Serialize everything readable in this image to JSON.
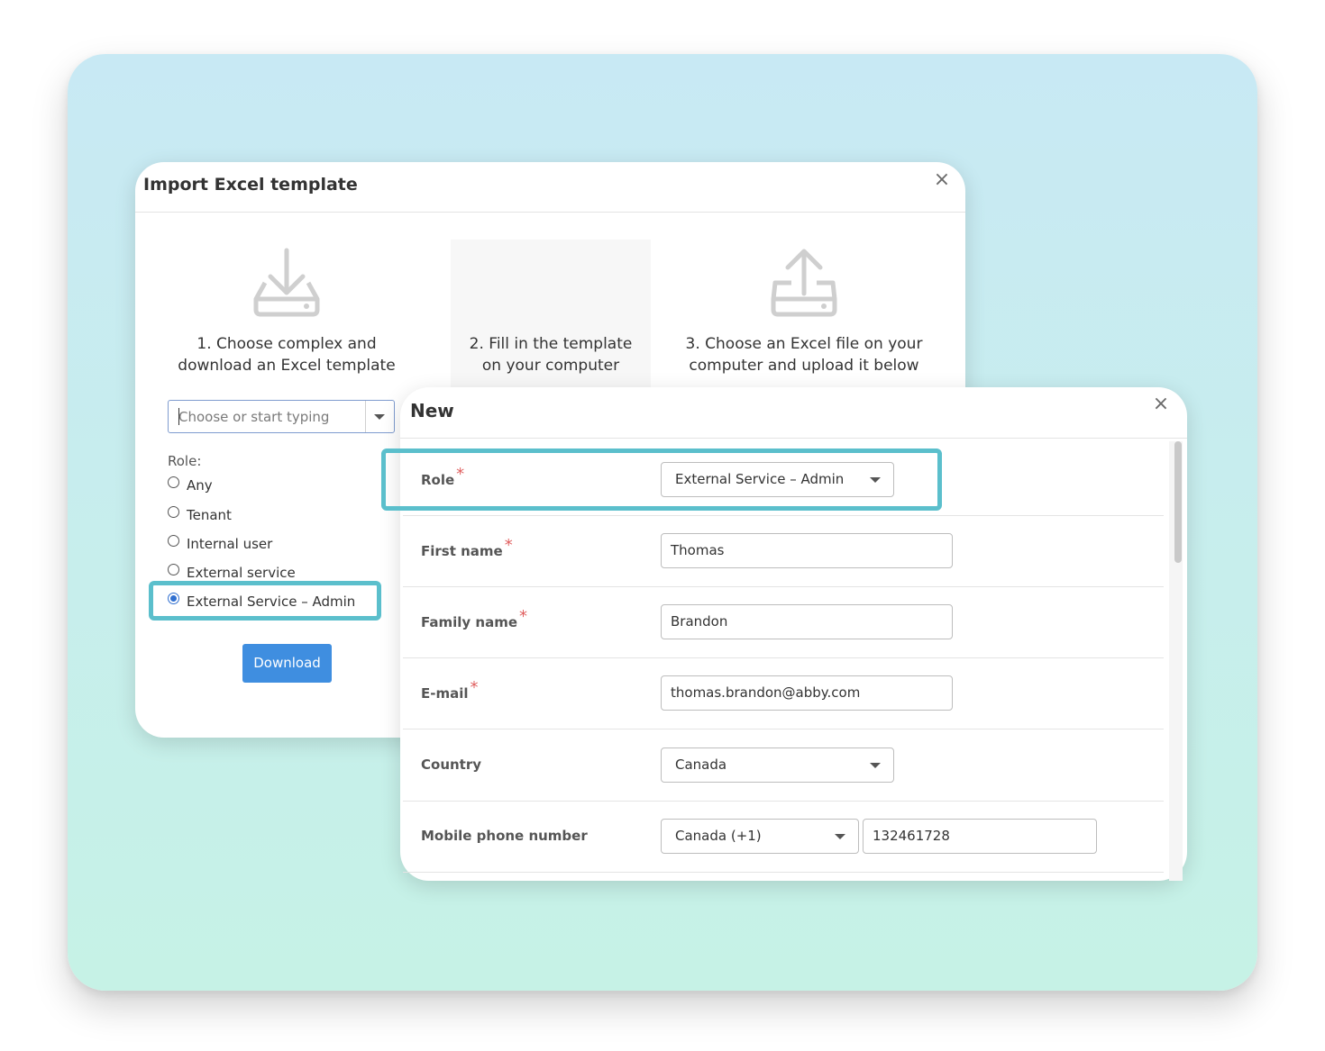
{
  "import_dialog": {
    "title": "Import Excel template",
    "close": "×",
    "steps": [
      {
        "icon": "download-tray-icon",
        "line1": "1. Choose complex and",
        "line2": "download an Excel template"
      },
      {
        "icon": "",
        "line1": "2. Fill in the template",
        "line2": "on your computer"
      },
      {
        "icon": "upload-tray-icon",
        "line1": "3. Choose an Excel file on your",
        "line2": "computer and upload it below"
      }
    ],
    "complex_select": {
      "placeholder": "Choose or start typing"
    },
    "role_label": "Role:",
    "roles": [
      "Any",
      "Tenant",
      "Internal user",
      "External service",
      "External Service – Admin"
    ],
    "selected_role": "External Service – Admin",
    "download_button": "Download"
  },
  "new_dialog": {
    "title": "New",
    "close": "×",
    "fields": {
      "role": {
        "label": "Role",
        "required": "*",
        "value": "External Service – Admin"
      },
      "first_name": {
        "label": "First name",
        "required": "*",
        "value": "Thomas"
      },
      "family_name": {
        "label": "Family name",
        "required": "*",
        "value": "Brandon"
      },
      "email": {
        "label": "E-mail",
        "required": "*",
        "value": "thomas.brandon@abby.com"
      },
      "country": {
        "label": "Country",
        "value": "Canada"
      },
      "mobile": {
        "label": "Mobile phone number",
        "country_code": "Canada (+1)",
        "number": "132461728"
      }
    }
  },
  "colors": {
    "highlight": "#5bbfcc",
    "primary_button": "#3f8ee0",
    "required_marker": "#e06060",
    "background_top": "#c8e9f4",
    "background_bottom": "#c6f2e6"
  }
}
